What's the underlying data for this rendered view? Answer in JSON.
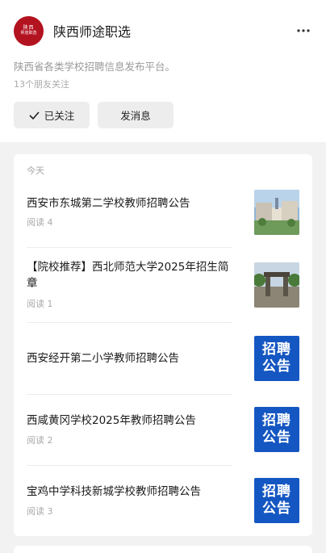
{
  "account": {
    "avatar_line1": "陕西",
    "avatar_line2": "师途职选",
    "name": "陕西师途职选",
    "description": "陕西省各类学校招聘信息发布平台。",
    "friends_following": "13个朋友关注"
  },
  "buttons": {
    "follow_label": "已关注",
    "message_label": "发消息"
  },
  "feed": {
    "section_label": "今天",
    "items": [
      {
        "title": "西安市东城第二学校教师招聘公告",
        "reads": "阅读 4",
        "thumb": "campus-photo"
      },
      {
        "title": "【院校推荐】西北师范大学2025年招生简章",
        "reads": "阅读 1",
        "thumb": "gate-photo"
      },
      {
        "title": "西安经开第二小学教师招聘公告",
        "reads": "",
        "thumb": "recruit-badge",
        "badge_l1": "招聘",
        "badge_l2": "公告"
      },
      {
        "title": "西咸黄冈学校2025年教师招聘公告",
        "reads": "阅读 2",
        "thumb": "recruit-badge",
        "badge_l1": "招聘",
        "badge_l2": "公告"
      },
      {
        "title": "宝鸡中学科技新城学校教师招聘公告",
        "reads": "阅读 3",
        "thumb": "recruit-badge",
        "badge_l1": "招聘",
        "badge_l2": "公告"
      }
    ]
  },
  "colors": {
    "brand_red": "#b3121f",
    "badge_blue": "#1557c2",
    "page_bg": "#f2f2f2"
  },
  "icons": {
    "more": "more-dots-icon",
    "follow_check": "checkmark-icon"
  }
}
